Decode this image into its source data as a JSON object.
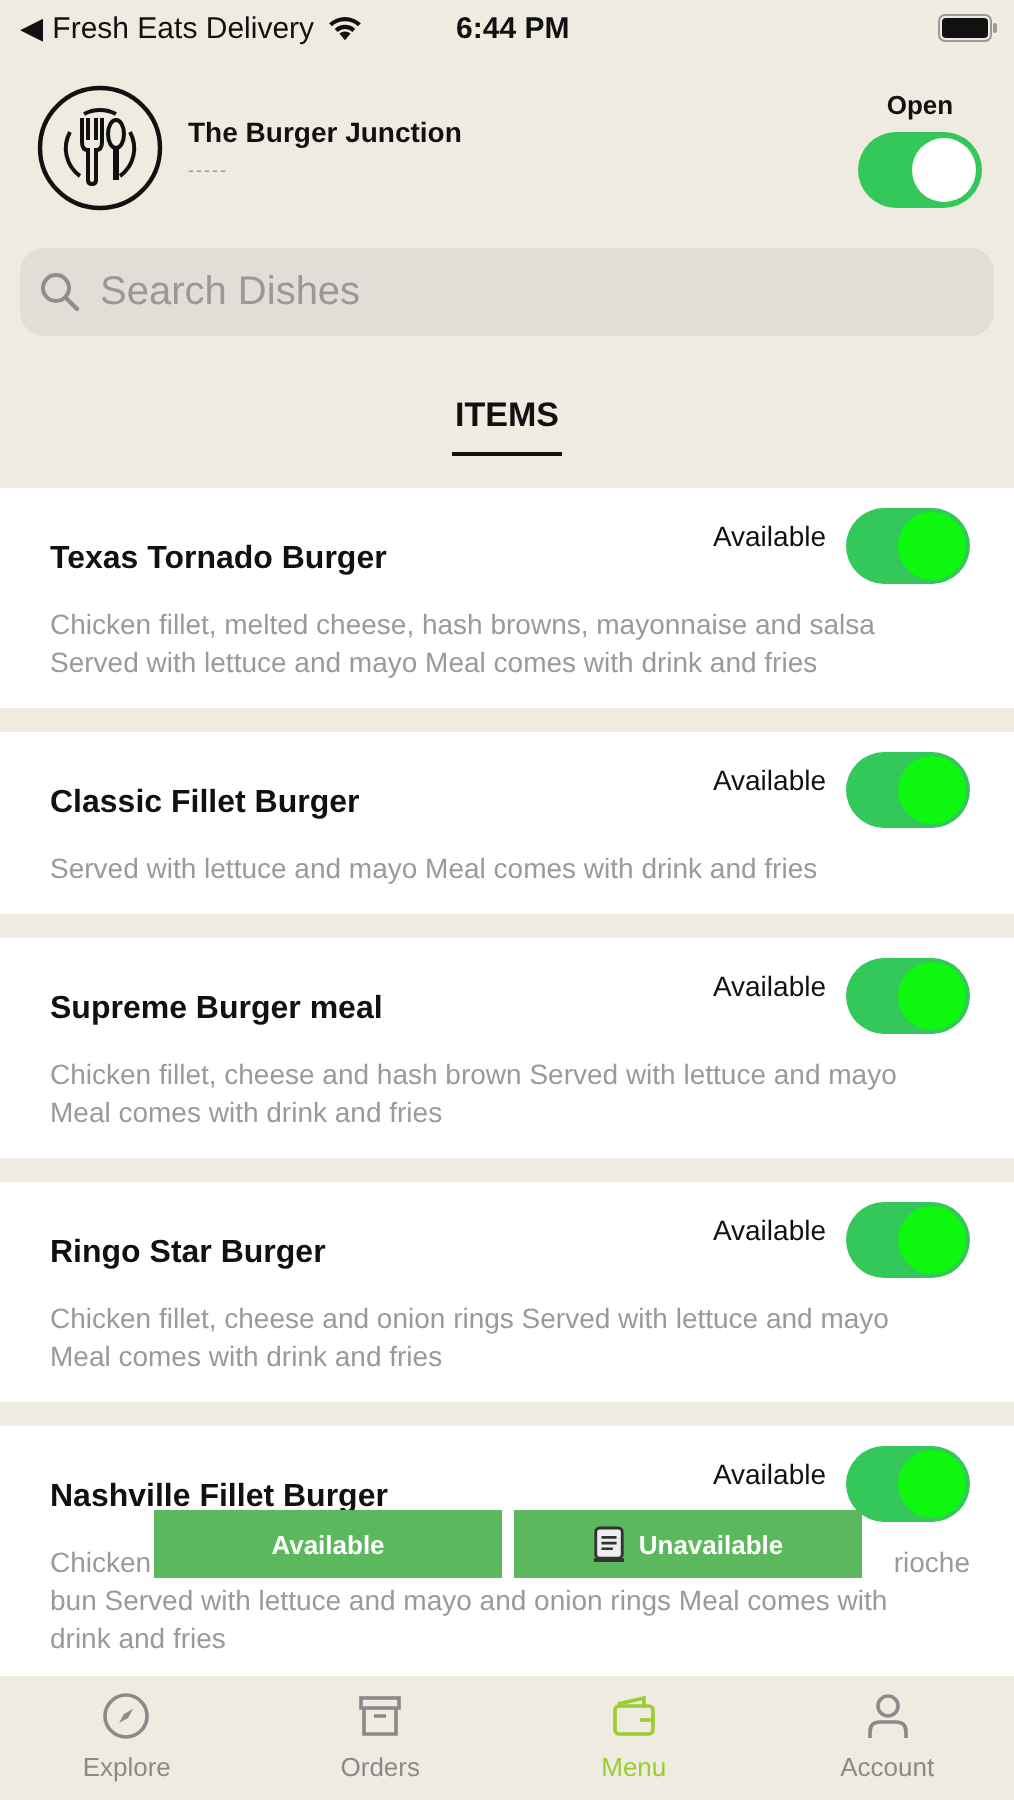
{
  "status_bar": {
    "back_label": "◀ Fresh Eats Delivery",
    "time": "6:44 PM"
  },
  "restaurant": {
    "name": "The Burger Junction",
    "subtitle": "-----",
    "open_label": "Open",
    "open": true
  },
  "search": {
    "placeholder": "Search Dishes"
  },
  "section_tab": {
    "label": "ITEMS",
    "selected": true
  },
  "items": [
    {
      "name": "Texas Tornado Burger",
      "status_label": "Available",
      "available": true,
      "lines": [
        [
          "Chicken fillet, melted cheese, hash browns, mayonnaise and salsa"
        ],
        [
          "Served with lettuce and mayo Meal comes with drink and fries"
        ]
      ]
    },
    {
      "name": "Classic Fillet Burger",
      "status_label": "Available",
      "available": true,
      "lines": [
        [
          "Served with lettuce and mayo Meal comes with drink and fries"
        ]
      ]
    },
    {
      "name": "Supreme Burger meal",
      "status_label": "Available",
      "available": true,
      "lines": [
        [
          "Chicken fillet, cheese and hash brown Served with lettuce and mayo"
        ],
        [
          "Meal comes with drink and fries"
        ]
      ]
    },
    {
      "name": "Ringo Star Burger",
      "status_label": "Available",
      "available": true,
      "lines": [
        [
          "Chicken fillet, cheese and onion rings Served with lettuce and mayo"
        ],
        [
          "Meal comes with drink and fries"
        ]
      ]
    },
    {
      "name": "Nashville Fillet Burger",
      "status_label": "Available",
      "available": true,
      "lines": [
        [
          "Chicken",
          "rioche"
        ],
        [
          "bun Served with lettuce and mayo and onion rings Meal comes with"
        ],
        [
          "drink and fries"
        ]
      ]
    }
  ],
  "filter_buttons": [
    {
      "label": "Available",
      "kind": "text"
    },
    {
      "label": "Unavailable",
      "kind": "document"
    }
  ],
  "tab_bar": [
    {
      "label": "Explore",
      "kind": "compass",
      "selected": false
    },
    {
      "label": "Orders",
      "kind": "box",
      "selected": false
    },
    {
      "label": "Menu",
      "kind": "wallet",
      "selected": true
    },
    {
      "label": "Account",
      "kind": "person",
      "selected": false
    }
  ]
}
